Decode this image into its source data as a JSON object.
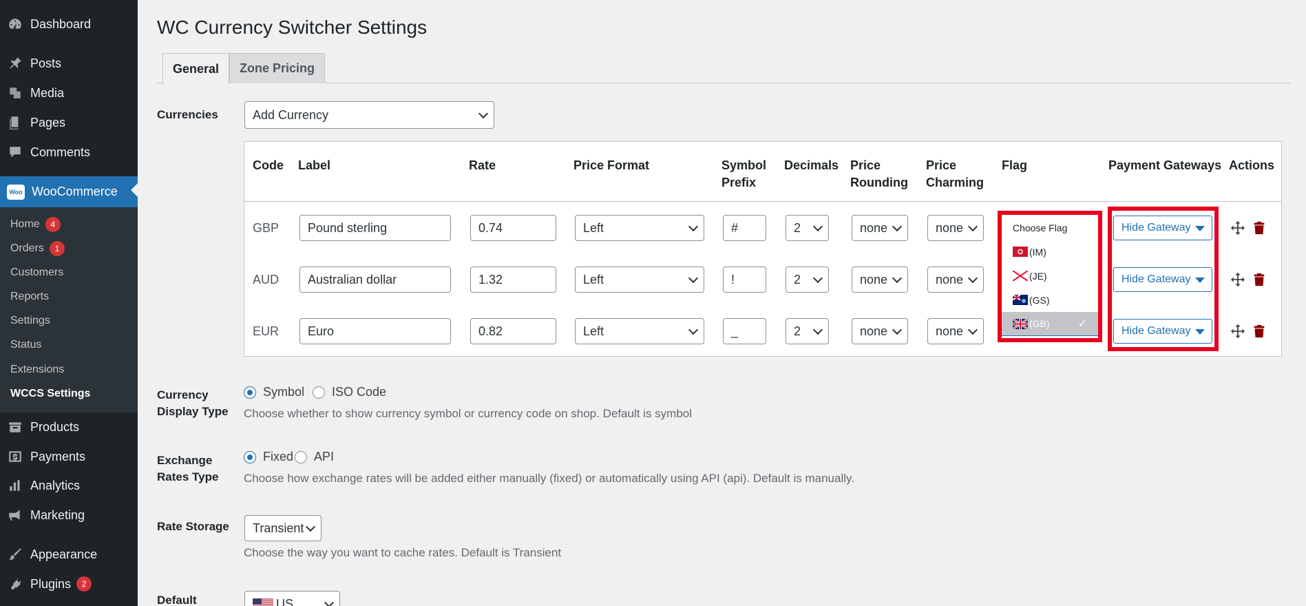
{
  "sidebar": {
    "items": [
      {
        "label": "Dashboard",
        "icon": "dashboard-icon"
      },
      {
        "label": "Posts",
        "icon": "pin-icon"
      },
      {
        "label": "Media",
        "icon": "media-icon"
      },
      {
        "label": "Pages",
        "icon": "pages-icon"
      },
      {
        "label": "Comments",
        "icon": "comment-icon"
      },
      {
        "label": "WooCommerce",
        "icon": "woo-icon"
      },
      {
        "label": "Products",
        "icon": "archive-icon"
      },
      {
        "label": "Payments",
        "icon": "dollar-icon"
      },
      {
        "label": "Analytics",
        "icon": "bar-chart-icon"
      },
      {
        "label": "Marketing",
        "icon": "megaphone-icon"
      },
      {
        "label": "Appearance",
        "icon": "brush-icon"
      },
      {
        "label": "Plugins",
        "icon": "plug-icon",
        "badge": "2"
      }
    ],
    "woo_logo": "Woo",
    "submenu": [
      {
        "label": "Home",
        "badge": "4"
      },
      {
        "label": "Orders",
        "badge": "1"
      },
      {
        "label": "Customers"
      },
      {
        "label": "Reports"
      },
      {
        "label": "Settings"
      },
      {
        "label": "Status"
      },
      {
        "label": "Extensions"
      },
      {
        "label": "WCCS Settings",
        "current": true
      }
    ]
  },
  "page": {
    "title": "WC Currency Switcher Settings",
    "tabs": [
      {
        "label": "General",
        "active": true
      },
      {
        "label": "Zone Pricing"
      }
    ]
  },
  "currencies": {
    "label": "Currencies",
    "add_select": "Add Currency",
    "headers": {
      "code": "Code",
      "label": "Label",
      "rate": "Rate",
      "price_format": "Price Format",
      "symbol_prefix": [
        "Symbol",
        "Prefix"
      ],
      "decimals": "Decimals",
      "price_rounding": [
        "Price",
        "Rounding"
      ],
      "price_charming": [
        "Price",
        "Charming"
      ],
      "flag": "Flag",
      "payment_gateways": "Payment Gateways",
      "actions": "Actions"
    },
    "rows": [
      {
        "code": "GBP",
        "label": "Pound sterling",
        "rate": "0.74",
        "format": "Left",
        "prefix": "#",
        "decimals": "2",
        "rounding": "none",
        "charming": "none",
        "gateway": "Hide Gateway"
      },
      {
        "code": "AUD",
        "label": "Australian dollar",
        "rate": "1.32",
        "format": "Left",
        "prefix": "!",
        "decimals": "2",
        "rounding": "none",
        "charming": "none",
        "gateway": "Hide Gateway"
      },
      {
        "code": "EUR",
        "label": "Euro",
        "rate": "0.82",
        "format": "Left",
        "prefix": "_",
        "decimals": "2",
        "rounding": "none",
        "charming": "none",
        "gateway": "Hide Gateway"
      }
    ],
    "flag_dropdown": {
      "header": "Choose Flag",
      "options": [
        {
          "code": "(IM)",
          "icon": "isle-of-man-flag-icon"
        },
        {
          "code": "(JE)",
          "icon": "jersey-flag-icon"
        },
        {
          "code": "(GS)",
          "icon": "south-georgia-flag-icon"
        },
        {
          "code": "(GB)",
          "icon": "uk-flag-icon",
          "selected": true
        }
      ],
      "check": "✓"
    }
  },
  "display_type": {
    "label": [
      "Currency",
      "Display Type"
    ],
    "options": [
      "Symbol",
      "ISO Code"
    ],
    "selected": "Symbol",
    "help": "Choose whether to show currency symbol or currency code on shop. Default is symbol"
  },
  "exchange": {
    "label": [
      "Exchange",
      "Rates Type"
    ],
    "options": [
      "Fixed",
      "API"
    ],
    "selected": "Fixed",
    "help": "Choose how exchange rates will be added either manually (fixed) or automatically using API (api). Default is manually."
  },
  "storage": {
    "label": "Rate Storage",
    "value": "Transient",
    "help": "Choose the way you want to cache rates. Default is Transient"
  },
  "default": {
    "label": "Default",
    "value": "US",
    "flag_icon": "us-flag-icon"
  },
  "colors": {
    "accent": "#2271b1",
    "highlight": "#e6001e",
    "sidebar": "#1d2327",
    "delete": "#8a0000"
  }
}
